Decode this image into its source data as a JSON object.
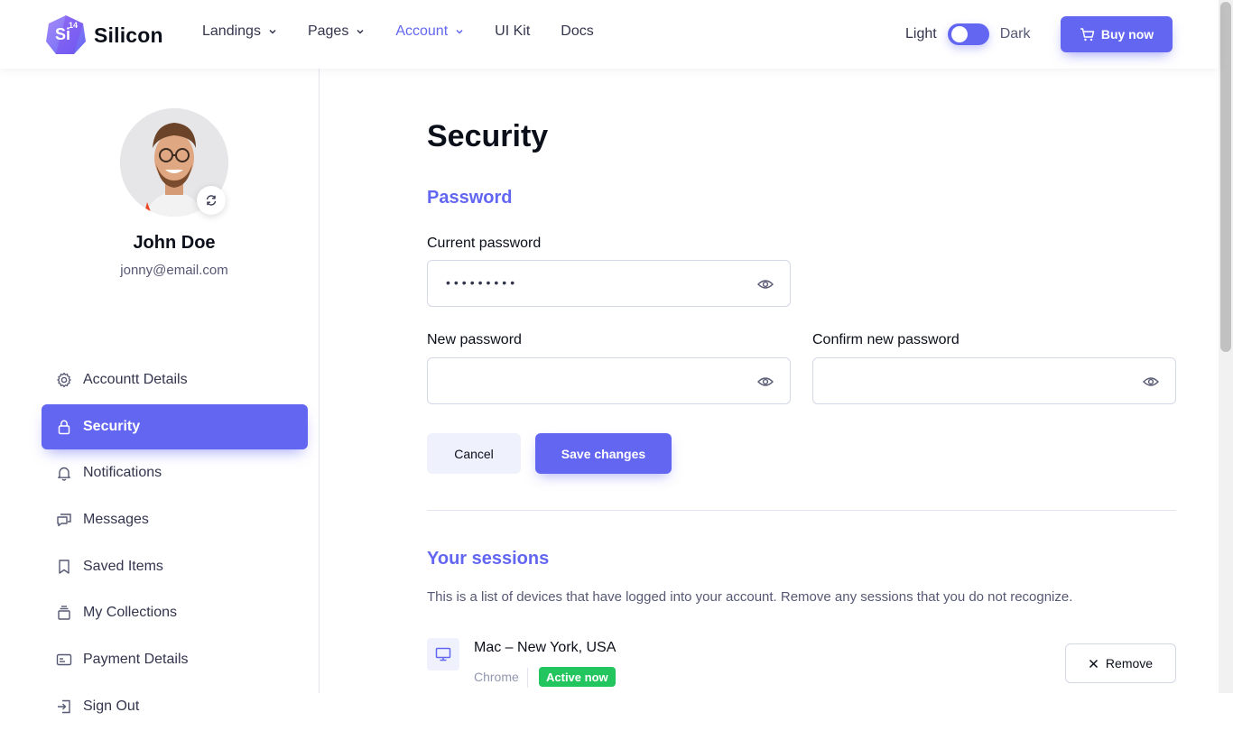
{
  "brand": {
    "name": "Silicon",
    "logo_mark": "Si",
    "logo_version": "14",
    "accent": "#6366f1"
  },
  "nav": {
    "items": [
      {
        "label": "Landings",
        "dropdown": true,
        "active": false
      },
      {
        "label": "Pages",
        "dropdown": true,
        "active": false
      },
      {
        "label": "Account",
        "dropdown": true,
        "active": true
      },
      {
        "label": "UI Kit",
        "dropdown": false,
        "active": false
      },
      {
        "label": "Docs",
        "dropdown": false,
        "active": false
      }
    ],
    "mode_light": "Light",
    "mode_dark": "Dark",
    "buy_label": "Buy now",
    "buy_icon": "cart-icon"
  },
  "profile": {
    "name": "John Doe",
    "email": "jonny@email.com"
  },
  "sidebar": {
    "items": [
      {
        "label": "Accountt Details",
        "icon": "gear-icon",
        "active": false
      },
      {
        "label": "Security",
        "icon": "lock-icon",
        "active": true
      },
      {
        "label": "Notifications",
        "icon": "bell-icon",
        "active": false
      },
      {
        "label": "Messages",
        "icon": "chat-icon",
        "active": false
      },
      {
        "label": "Saved Items",
        "icon": "bookmark-icon",
        "active": false
      },
      {
        "label": "My Collections",
        "icon": "collection-icon",
        "active": false
      },
      {
        "label": "Payment Details",
        "icon": "card-icon",
        "active": false
      },
      {
        "label": "Sign Out",
        "icon": "sign-out-icon",
        "active": false
      }
    ]
  },
  "main": {
    "title": "Security",
    "password_section": "Password",
    "current_password_label": "Current password",
    "current_password_value": "•••••••••",
    "new_password_label": "New password",
    "confirm_password_label": "Confirm new password",
    "cancel_label": "Cancel",
    "save_label": "Save changes",
    "sessions_title": "Your sessions",
    "sessions_desc": "This is a list of devices that have logged into your account. Remove any sessions that you do not recognize.",
    "session": {
      "device": "Mac – New York, USA",
      "browser": "Chrome",
      "status": "Active now",
      "remove_label": "Remove",
      "status_color": "#22c55e"
    }
  }
}
